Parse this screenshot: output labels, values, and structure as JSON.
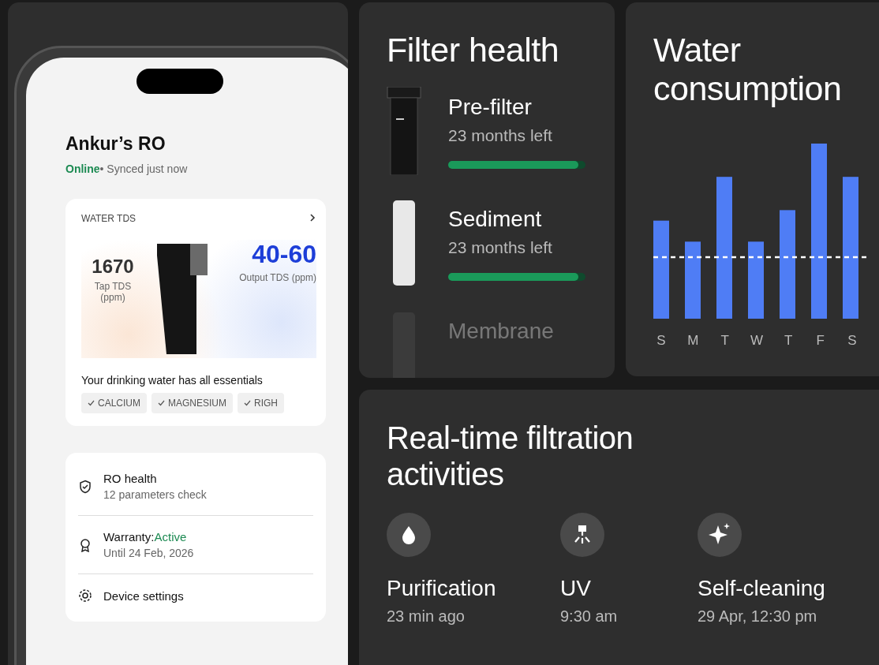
{
  "phone": {
    "title": "Ankur’s RO",
    "status": "Online",
    "sync": "• Synced just now",
    "tds": {
      "label": "WATER TDS",
      "tap_value": "1670",
      "tap_label": "Tap TDS (ppm)",
      "output_value": "40-60",
      "output_label": "Output TDS (ppm)",
      "message": "Your drinking water has all essentials",
      "chips": [
        "CALCIUM",
        "MAGNESIUM",
        "RIGH"
      ]
    },
    "list": [
      {
        "kind": "shield",
        "title": "RO health",
        "subtitle": "12 parameters check"
      },
      {
        "kind": "badge",
        "title": "Warranty:",
        "status": "Active",
        "subtitle": "Until 24 Feb, 2026"
      },
      {
        "kind": "gear",
        "title": "Device settings"
      }
    ]
  },
  "filter_health": {
    "title": "Filter health",
    "items": [
      {
        "kind": "housing",
        "name": "Pre-filter",
        "remaining": "23 months left",
        "level": 0.95,
        "dimmed": false
      },
      {
        "kind": "cartridge",
        "name": "Sediment",
        "remaining": "23 months left",
        "level": 0.95,
        "dimmed": false
      },
      {
        "kind": "cartridge",
        "name": "Membrane",
        "dimmed": true
      }
    ]
  },
  "water_consumption": {
    "title": "Water consumption",
    "days": [
      "S",
      "M",
      "T",
      "W",
      "T",
      "F",
      "S"
    ]
  },
  "activities": {
    "title": "Real-time filtration activities",
    "items": [
      {
        "kind": "drop",
        "name": "Purification",
        "time": "23 min ago"
      },
      {
        "kind": "uv",
        "name": "UV",
        "time": "9:30 am"
      },
      {
        "kind": "sparkle",
        "name": "Self-cleaning",
        "time": "29 Apr, 12:30 pm"
      }
    ]
  }
}
